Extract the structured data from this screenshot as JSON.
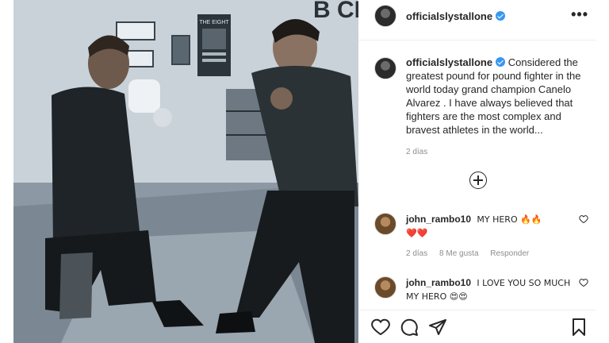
{
  "post": {
    "username": "officialslystallone",
    "caption_username": "officialslystallone",
    "caption": "Considered the greatest pound for pound fighter in the world today grand champion Canelo Alvarez . I have always believed that fighters are the most complex and bravest athletes in the world...",
    "time": "2 días",
    "more_icon": "•••"
  },
  "photo": {
    "poster_text": "THE EIGHT",
    "wall_letters": "B CH"
  },
  "comments": [
    {
      "username": "john_rambo10",
      "text": "MY HERO 🔥🔥",
      "text2": "❤️❤️",
      "time": "2 días",
      "likes": "8 Me gusta",
      "reply": "Responder"
    },
    {
      "username": "john_rambo10",
      "text": "I LOVE YOU SO MUCH MY HERO 😍😍"
    }
  ],
  "icons": {
    "verified": "verified-badge",
    "like": "heart-icon",
    "comment": "comment-icon",
    "share": "paper-plane-icon",
    "save": "bookmark-icon",
    "load_more": "plus-circle-icon"
  }
}
